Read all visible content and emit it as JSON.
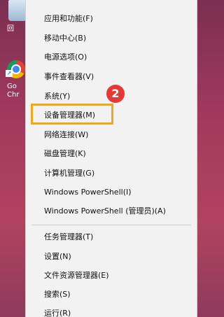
{
  "desktop": {
    "recycle_bin_label": "回",
    "chrome_label_line1": "Go",
    "chrome_label_line2": "Chr"
  },
  "annotation": {
    "step_number": "2",
    "highlight_color": "#f0a818",
    "badge_color": "#e53935"
  },
  "menu": {
    "items": [
      {
        "label": "应用和功能(F)"
      },
      {
        "label": "移动中心(B)"
      },
      {
        "label": "电源选项(O)"
      },
      {
        "label": "事件查看器(V)"
      },
      {
        "label": "系统(Y)"
      },
      {
        "label": "设备管理器(M)"
      },
      {
        "label": "网络连接(W)"
      },
      {
        "label": "磁盘管理(K)"
      },
      {
        "label": "计算机管理(G)"
      },
      {
        "label": "Windows PowerShell(I)"
      },
      {
        "label": "Windows PowerShell (管理员)(A)"
      },
      {
        "label": "任务管理器(T)"
      },
      {
        "label": "设置(N)"
      },
      {
        "label": "文件资源管理器(E)"
      },
      {
        "label": "搜索(S)"
      },
      {
        "label": "运行(R)"
      }
    ]
  }
}
